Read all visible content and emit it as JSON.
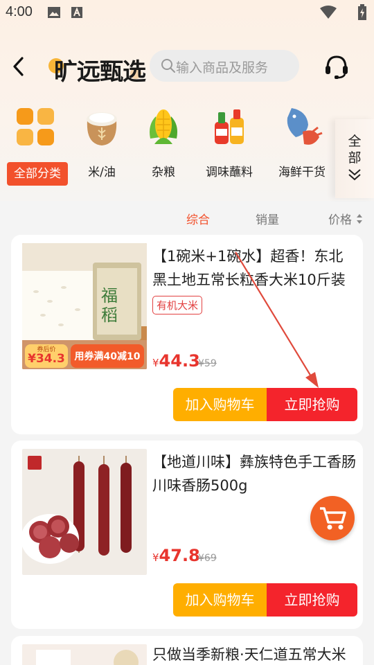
{
  "status_bar": {
    "time": "4:00",
    "icons": [
      "image-icon",
      "font-icon",
      "wifi-icon",
      "battery-icon"
    ]
  },
  "header": {
    "back_icon": "chevron-left-icon",
    "logo_text": "旷远甄选",
    "search_placeholder": "输入商品及服务",
    "service_icon": "headset-icon"
  },
  "categories": [
    {
      "label": "全部分类",
      "icon": "grid-icon",
      "active": true
    },
    {
      "label": "米/油",
      "icon": "rice-sack-icon",
      "active": false
    },
    {
      "label": "杂粮",
      "icon": "corn-icon",
      "active": false
    },
    {
      "label": "调味蘸料",
      "icon": "sauce-bottle-icon",
      "active": false
    },
    {
      "label": "海鲜干货",
      "icon": "seafood-icon",
      "active": false
    }
  ],
  "all_toggle": {
    "line1": "全",
    "line2": "部"
  },
  "sort_bar": {
    "options": [
      "综合",
      "销量",
      "价格"
    ],
    "active": "综合"
  },
  "products": [
    {
      "title": "【1碗米+1碗水】超香！东北黑土地五常长粒香大米10斤装",
      "tag": "有机大米",
      "price": "44.3",
      "old_price": "59",
      "currency": "¥",
      "thumb_badge_small": "券后价",
      "thumb_badge_price": "¥34.3",
      "thumb_coupon": "用券满40减10",
      "cart_label": "加入购物车",
      "buy_label": "立即抢购"
    },
    {
      "title": "【地道川味】彝族特色手工香肠川味香肠500g",
      "price": "47.8",
      "old_price": "69",
      "currency": "¥",
      "cart_label": "加入购物车",
      "buy_label": "立即抢购"
    },
    {
      "title": "只做当季新粮·天仁道五常大米"
    }
  ],
  "colors": {
    "accent": "#f2512c",
    "price": "#e8352e",
    "cart_button": "#ffae00",
    "buy_button": "#f4242c"
  }
}
